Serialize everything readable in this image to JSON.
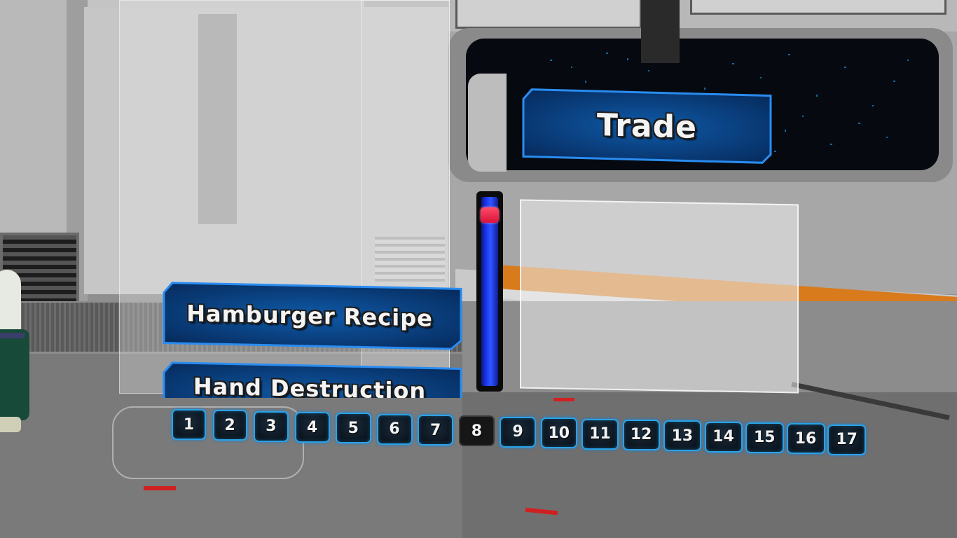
{
  "trade_button": {
    "label": "Trade"
  },
  "recipe_list": {
    "items": [
      {
        "label": "Hamburger Recipe"
      },
      {
        "label": "Hand Destruction"
      }
    ],
    "scroll_position": 0.06
  },
  "pagination": {
    "pages": [
      "1",
      "2",
      "3",
      "4",
      "5",
      "6",
      "7",
      "8",
      "9",
      "10",
      "11",
      "12",
      "13",
      "14",
      "15",
      "16",
      "17"
    ],
    "current_page": "8"
  },
  "colors": {
    "button_fill": "#0a3a7a",
    "button_border": "#2a8cf0",
    "scroll_track": "#1f3bff",
    "scroll_thumb": "#e01a40",
    "page_border": "#2aa3e8"
  }
}
